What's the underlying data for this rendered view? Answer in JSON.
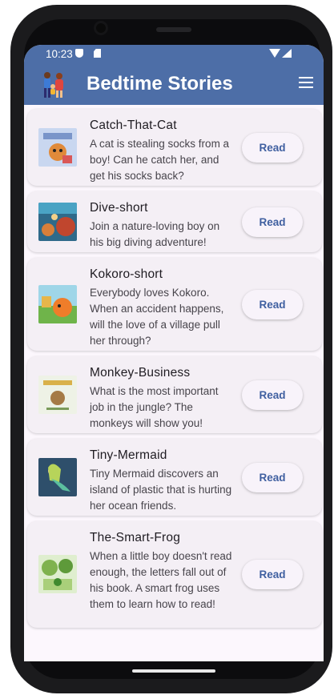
{
  "status_bar": {
    "time": "10:23"
  },
  "app_bar": {
    "title": "Bedtime Stories"
  },
  "stories": [
    {
      "title": "Catch-That-Cat",
      "description": "A cat is stealing socks from a boy! Can he catch her, and get his socks back?",
      "button": "Read"
    },
    {
      "title": "Dive-short",
      "description": "Join a nature-loving boy on his big diving adventure!",
      "button": "Read"
    },
    {
      "title": "Kokoro-short",
      "description": "Everybody loves Kokoro. When an accident happens, will the love of a village pull her through?",
      "button": "Read"
    },
    {
      "title": "Monkey-Business",
      "description": "What is the most important job in the jungle? The monkeys will show you!",
      "button": "Read"
    },
    {
      "title": "Tiny-Mermaid",
      "description": "Tiny Mermaid discovers an island of plastic that is hurting her ocean friends.",
      "button": "Read"
    },
    {
      "title": "The-Smart-Frog",
      "description": "When a little boy doesn't read enough, the letters fall out of his book. A smart frog uses them to learn how to read!",
      "button": "Read"
    }
  ],
  "colors": {
    "app_bar": "#4d6ea7",
    "background": "#fcf7fd",
    "card": "#f4eff5",
    "button_text": "#3f5fa0"
  }
}
